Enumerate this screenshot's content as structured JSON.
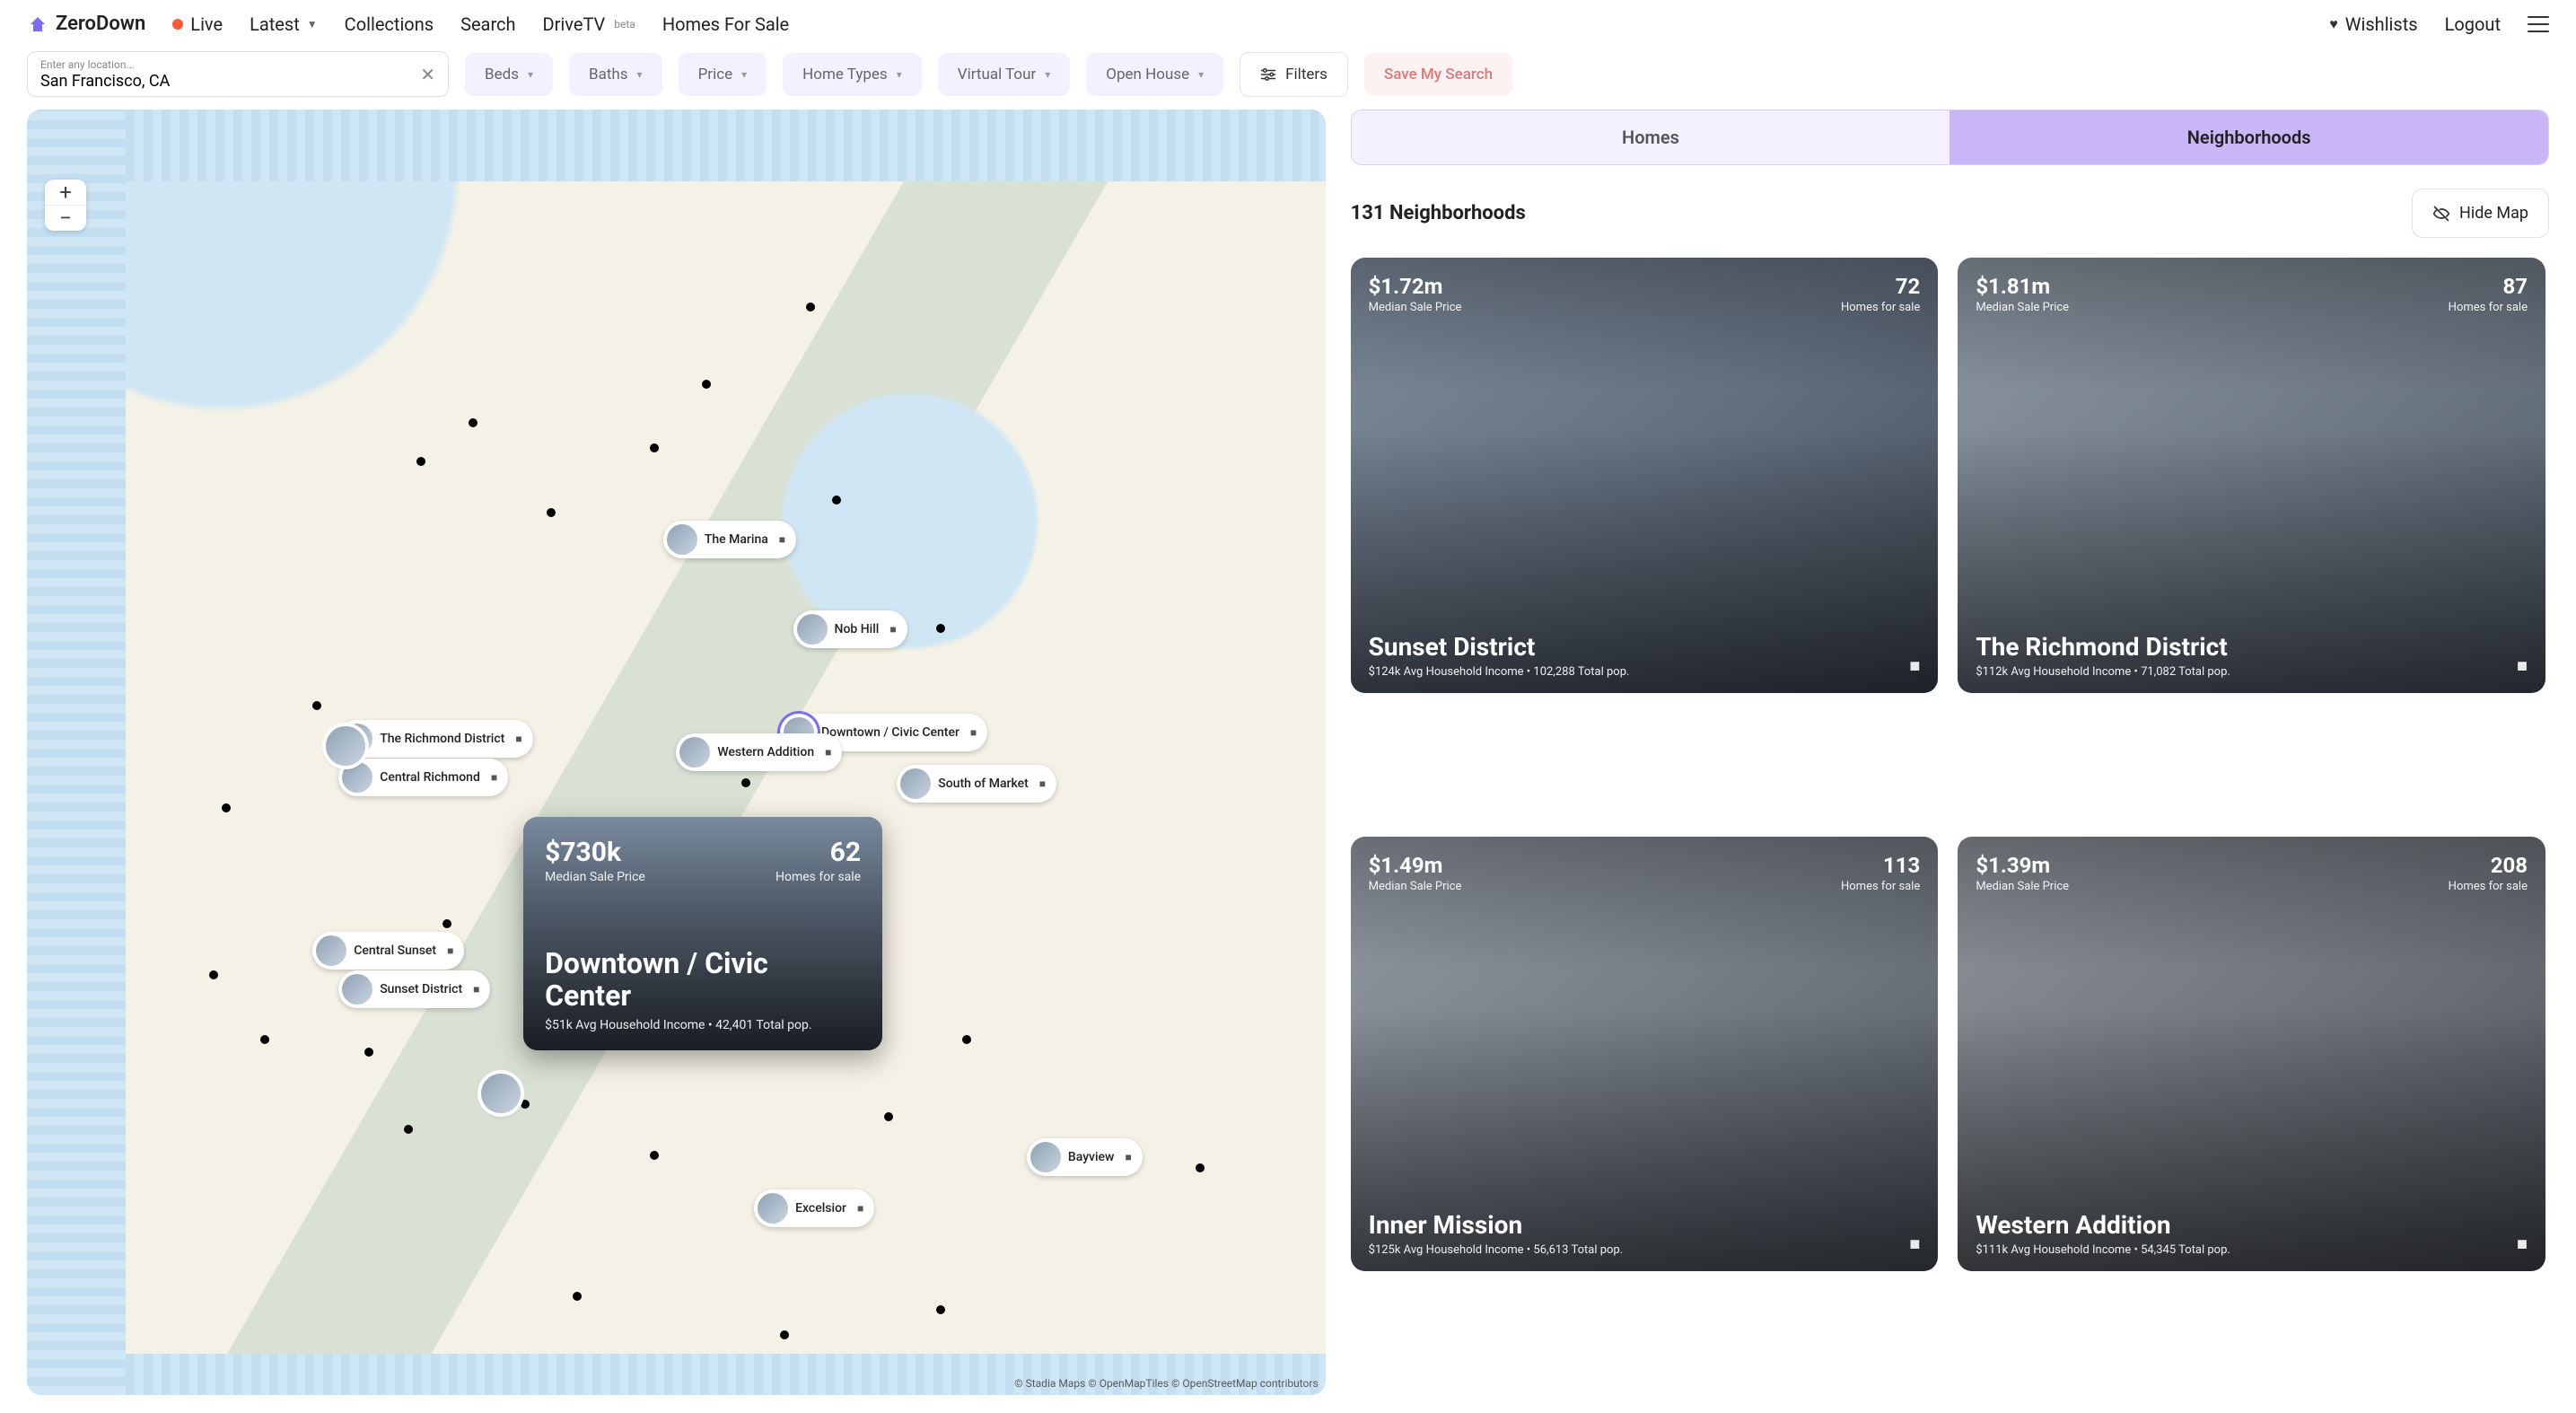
{
  "brand": "ZeroDown",
  "nav": {
    "live": "Live",
    "latest": "Latest",
    "collections": "Collections",
    "search": "Search",
    "drivetv": "DriveTV",
    "drivetv_badge": "beta",
    "homes_for_sale": "Homes For Sale",
    "wishlists": "Wishlists",
    "logout": "Logout"
  },
  "search": {
    "placeholder": "Enter any location...",
    "value": "San Francisco, CA"
  },
  "filters": {
    "beds": "Beds",
    "baths": "Baths",
    "price": "Price",
    "home_types": "Home Types",
    "virtual_tour": "Virtual Tour",
    "open_house": "Open House",
    "filters_btn": "Filters",
    "save_search": "Save My Search"
  },
  "toggle": {
    "homes": "Homes",
    "neighborhoods": "Neighborhoods"
  },
  "results_header": {
    "count_text": "131 Neighborhoods",
    "hide_map": "Hide Map"
  },
  "map": {
    "zoom_in": "+",
    "zoom_out": "−",
    "pins": {
      "marina": "The Marina",
      "nob_hill": "Nob Hill",
      "downtown": "Downtown / Civic Center",
      "richmond_district": "The Richmond District",
      "central_richmond": "Central Richmond",
      "western_addition": "Western Addition",
      "south_of_market": "South of Market",
      "central_sunset": "Central Sunset",
      "sunset_district": "Sunset District",
      "bayview": "Bayview",
      "excelsior": "Excelsior"
    },
    "hover": {
      "price": "$730k",
      "price_label": "Median Sale Price",
      "count": "62",
      "count_label": "Homes for sale",
      "name": "Downtown / Civic Center",
      "meta": "$51k Avg Household Income • 42,401 Total pop."
    },
    "attribution": "© Stadia Maps © OpenMapTiles © OpenStreetMap contributors"
  },
  "cards": [
    {
      "price": "$1.72m",
      "price_label": "Median Sale Price",
      "count": "72",
      "count_label": "Homes for sale",
      "name": "Sunset District",
      "meta": "$124k Avg Household Income • 102,288 Total pop."
    },
    {
      "price": "$1.81m",
      "price_label": "Median Sale Price",
      "count": "87",
      "count_label": "Homes for sale",
      "name": "The Richmond District",
      "meta": "$112k Avg Household Income • 71,082 Total pop."
    },
    {
      "price": "$1.49m",
      "price_label": "Median Sale Price",
      "count": "113",
      "count_label": "Homes for sale",
      "name": "Inner Mission",
      "meta": "$125k Avg Household Income • 56,613 Total pop."
    },
    {
      "price": "$1.39m",
      "price_label": "Median Sale Price",
      "count": "208",
      "count_label": "Homes for sale",
      "name": "Western Addition",
      "meta": "$111k Avg Household Income • 54,345 Total pop."
    }
  ]
}
